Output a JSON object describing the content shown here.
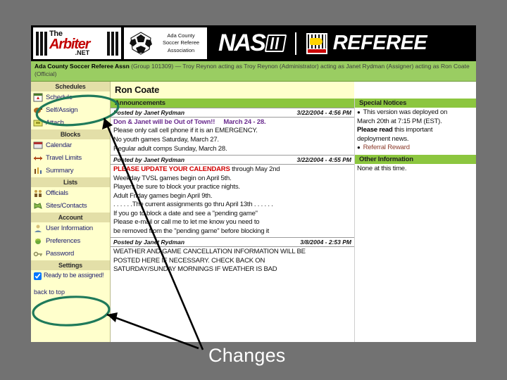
{
  "slide": {
    "caption": "Changes",
    "background_color": "#727272"
  },
  "header": {
    "arbiter_logo": {
      "the": "The",
      "name": "Arbiter",
      "net": ".NET"
    },
    "association_logo": {
      "line1": "Ada County",
      "line2": "Soccer Referee",
      "line3": "Association"
    },
    "naso_text": "NAS",
    "referee_text": "REFEREE"
  },
  "context_bar": {
    "org": "Ada County Soccer Referee Assn",
    "group": "(Group 101309)",
    "dash": "—",
    "acting_chain": "Troy Reynon acting as Troy Reynon (Administrator) acting as Janet Rydman (Assigner) acting as Ron Coate (Official)"
  },
  "sidebar": {
    "sections": [
      {
        "title": "Schedules",
        "items": [
          {
            "label": "Schedule",
            "icon": "calendar-icon"
          },
          {
            "label": "Self/Assign",
            "icon": "whistle-icon"
          },
          {
            "label": "Attach",
            "icon": "attach-icon"
          }
        ]
      },
      {
        "title": "Blocks",
        "items": [
          {
            "label": "Calendar",
            "icon": "calendar-icon"
          },
          {
            "label": "Travel Limits",
            "icon": "travel-icon"
          },
          {
            "label": "Summary",
            "icon": "summary-icon"
          }
        ]
      },
      {
        "title": "Lists",
        "items": [
          {
            "label": "Officials",
            "icon": "people-icon"
          },
          {
            "label": "Sites/Contacts",
            "icon": "map-icon"
          }
        ]
      },
      {
        "title": "Account",
        "items": [
          {
            "label": "User Information",
            "icon": "user-icon"
          },
          {
            "label": "Preferences",
            "icon": "preferences-icon"
          },
          {
            "label": "Password",
            "icon": "key-icon"
          }
        ]
      }
    ],
    "settings": {
      "title": "Settings",
      "ready_checkbox_label": "Ready to be assigned!",
      "ready_checked": true
    },
    "back_to_top": "back to top"
  },
  "main": {
    "page_title": "Ron Coate",
    "announcements_heading": "Announcements",
    "announcements": [
      {
        "posted_by": "Posted by  Janet Rydman",
        "timestamp": "3/22/2004 - 4:56 PM",
        "headline": "Don & Janet will be Out of Town!!",
        "headline_suffix": "March 24 - 28.",
        "lines": [
          "Please only call cell phone if it is an EMERGENCY.",
          "No youth games Saturday, March 27.",
          "Regular adult comps Sunday, March 28."
        ]
      },
      {
        "posted_by": "Posted by  Janet Rydman",
        "timestamp": "3/22/2004 - 4:55 PM",
        "headline": "PLEASE UPDATE YOUR CALENDARS",
        "headline_suffix": "through May 2nd",
        "lines": [
          "Weekday TVSL games begin on April 5th.",
          "Players be sure to block your practice nights.",
          "Adult Friday games begin April 9th.",
          ". . . . . .The current assignments go thru April 13th . . . . . .",
          "If you go to block a date and see a \"pending game\"",
          "Please e-mail or call me to let me know you need to",
          "be removed from the \"pending game\" before blocking it"
        ]
      },
      {
        "posted_by": "Posted by  Janet Rydman",
        "timestamp": "3/8/2004 - 2:53 PM",
        "headline": "",
        "headline_suffix": "",
        "lines": [
          "WEATHER AND GAME CANCELLATION INFORMATION WILL BE",
          "POSTED HERE IF NECESSARY. CHECK BACK ON",
          "SATURDAY/SUNDAY MORNINGS IF WEATHER IS BAD"
        ]
      }
    ]
  },
  "right_panel": {
    "special_notices_heading": "Special Notices",
    "notice_line_1": "This version was deployed on",
    "notice_line_2": "March 20th at 7:15 PM (EST).",
    "notice_bold": "Please read",
    "notice_line_3": "this important",
    "notice_line_4": "deployment news.",
    "referral_reward": "Referral Reward",
    "other_information_heading": "Other Information",
    "other_information_body": "None at this time."
  },
  "colors": {
    "header_green": "#8cc63f",
    "context_green": "#9acd62",
    "sidebar_yellow": "#ffffcc",
    "sidebar_head": "#e3dfa8",
    "annotation_green": "#1f7a5a",
    "link_blue": "#1c1c6e",
    "emergency_red": "#d10000"
  }
}
